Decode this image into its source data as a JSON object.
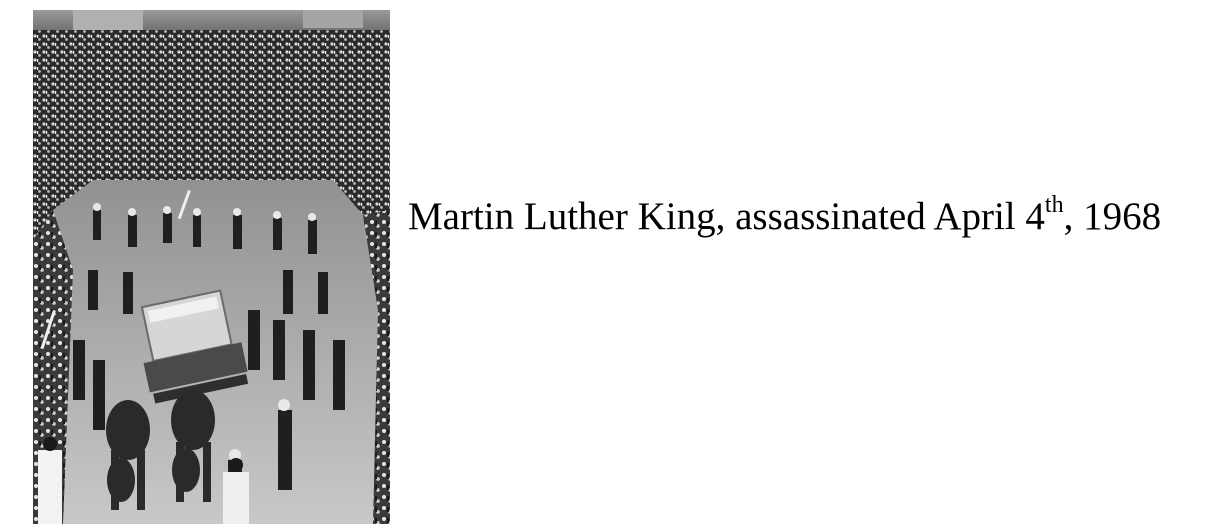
{
  "photo": {
    "alt_subject": "funeral procession photograph",
    "tone": "black-and-white"
  },
  "caption": {
    "main": "Martin Luther King, assassinated April 4",
    "superscript": "th",
    "tail": ", 1968"
  },
  "colors": {
    "background": "#ffffff",
    "text": "#000000"
  }
}
